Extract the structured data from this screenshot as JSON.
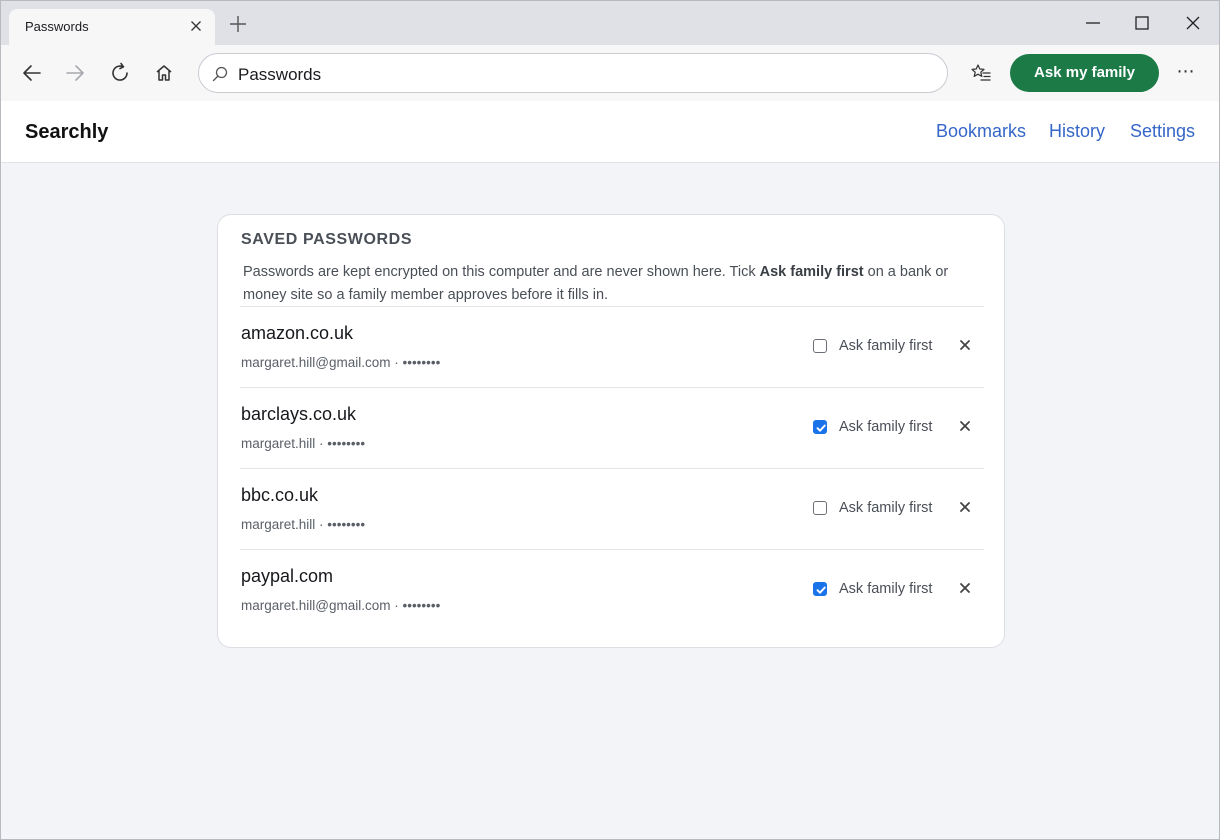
{
  "browser": {
    "tab_title": "Passwords",
    "address_text": "Passwords",
    "ask_family_label": "Ask my family",
    "more_label": "⋯"
  },
  "site": {
    "brand": "Searchly",
    "nav": [
      "Bookmarks",
      "History",
      "Settings"
    ]
  },
  "passwords_card": {
    "title": "SAVED PASSWORDS",
    "desc_prefix": "Passwords are kept encrypted on this computer and are never shown here. Tick ",
    "desc_bold": "Ask family first",
    "desc_suffix": " on a bank or money site so a family member approves before it fills in.",
    "checkbox_label": "Ask family first",
    "entries": [
      {
        "site": "amazon.co.uk",
        "username": "margaret.hill@gmail.com",
        "masked": "••••••••",
        "ask_family_first": false
      },
      {
        "site": "barclays.co.uk",
        "username": "margaret.hill",
        "masked": "••••••••",
        "ask_family_first": true
      },
      {
        "site": "bbc.co.uk",
        "username": "margaret.hill",
        "masked": "••••••••",
        "ask_family_first": false
      },
      {
        "site": "paypal.com",
        "username": "margaret.hill@gmail.com",
        "masked": "••••••••",
        "ask_family_first": true
      }
    ]
  },
  "colors": {
    "accent_green": "#1c7a47",
    "link_blue": "#3566c8",
    "checkbox_blue": "#1a73e8"
  }
}
